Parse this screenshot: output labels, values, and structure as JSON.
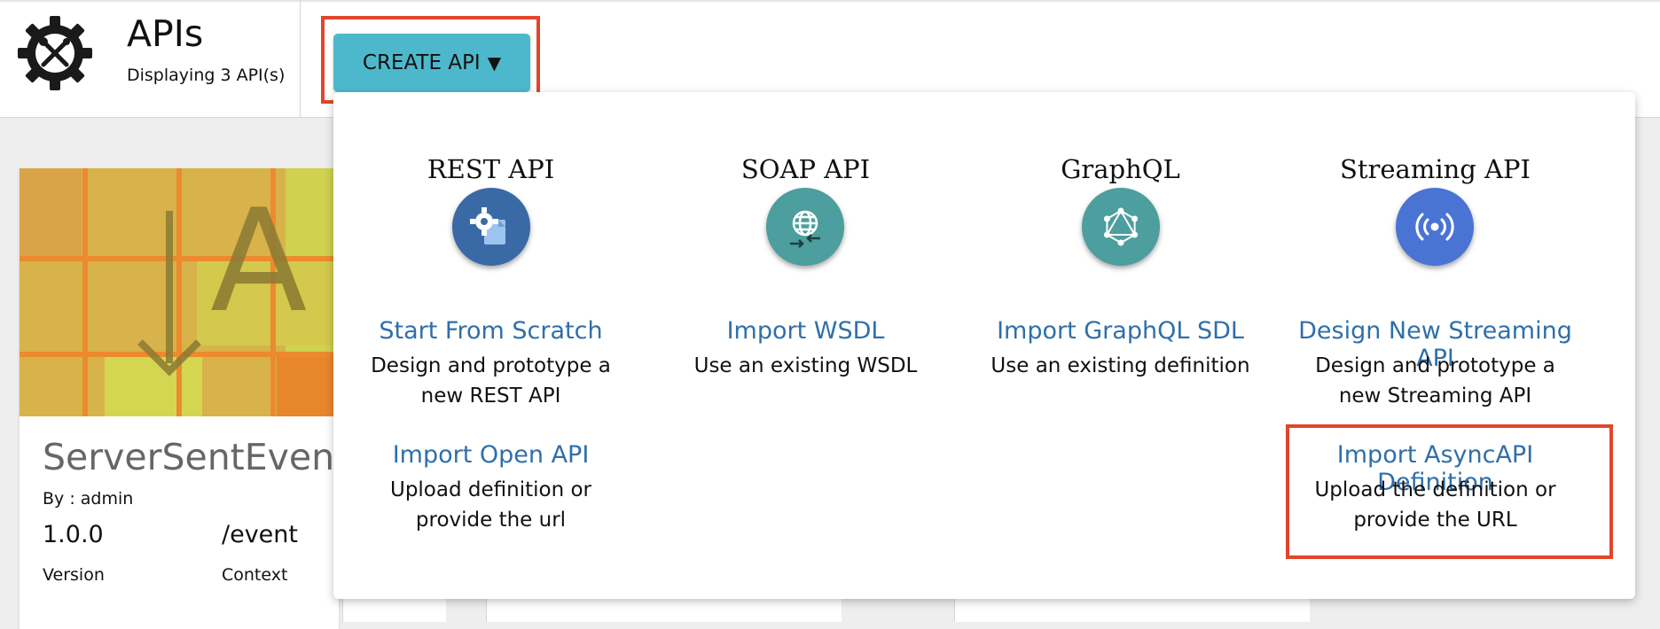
{
  "header": {
    "title": "APIs",
    "subtitle": "Displaying 3 API(s)",
    "logo_icon": "gear-wrench-icon"
  },
  "create_button": {
    "label": "CREATE API",
    "caret": "▼",
    "color": "#4db8cc"
  },
  "card": {
    "thumbnail_letters": "A",
    "name": "ServerSentEvent",
    "by": "By : admin",
    "version": "1.0.0",
    "context": "/event",
    "version_label": "Version",
    "context_label": "Context"
  },
  "menu": {
    "columns": [
      {
        "heading": "REST API",
        "icon": "rest-settings-icon",
        "color": "#3a6aa5",
        "options": [
          {
            "title": "Start From Scratch",
            "desc": "Design and prototype a new REST API"
          },
          {
            "title": "Import Open API",
            "desc": "Upload definition or provide the url"
          }
        ]
      },
      {
        "heading": "SOAP API",
        "icon": "globe-import-icon",
        "color": "#4d9e9e",
        "options": [
          {
            "title": "Import WSDL",
            "desc": "Use an existing WSDL"
          }
        ]
      },
      {
        "heading": "GraphQL",
        "icon": "graphql-icon",
        "color": "#4d9e9e",
        "options": [
          {
            "title": "Import GraphQL SDL",
            "desc": "Use an existing definition"
          }
        ]
      },
      {
        "heading": "Streaming API",
        "icon": "broadcast-icon",
        "color": "#4a74d4",
        "options": [
          {
            "title": "Design New Streaming API",
            "desc": "Design and prototype a new Streaming API"
          },
          {
            "title": "Import AsyncAPI Definition",
            "desc": "Upload the definition or provide the URL"
          }
        ]
      }
    ]
  },
  "colors": {
    "link": "#2f6fa9",
    "highlight": "#e2452b"
  }
}
